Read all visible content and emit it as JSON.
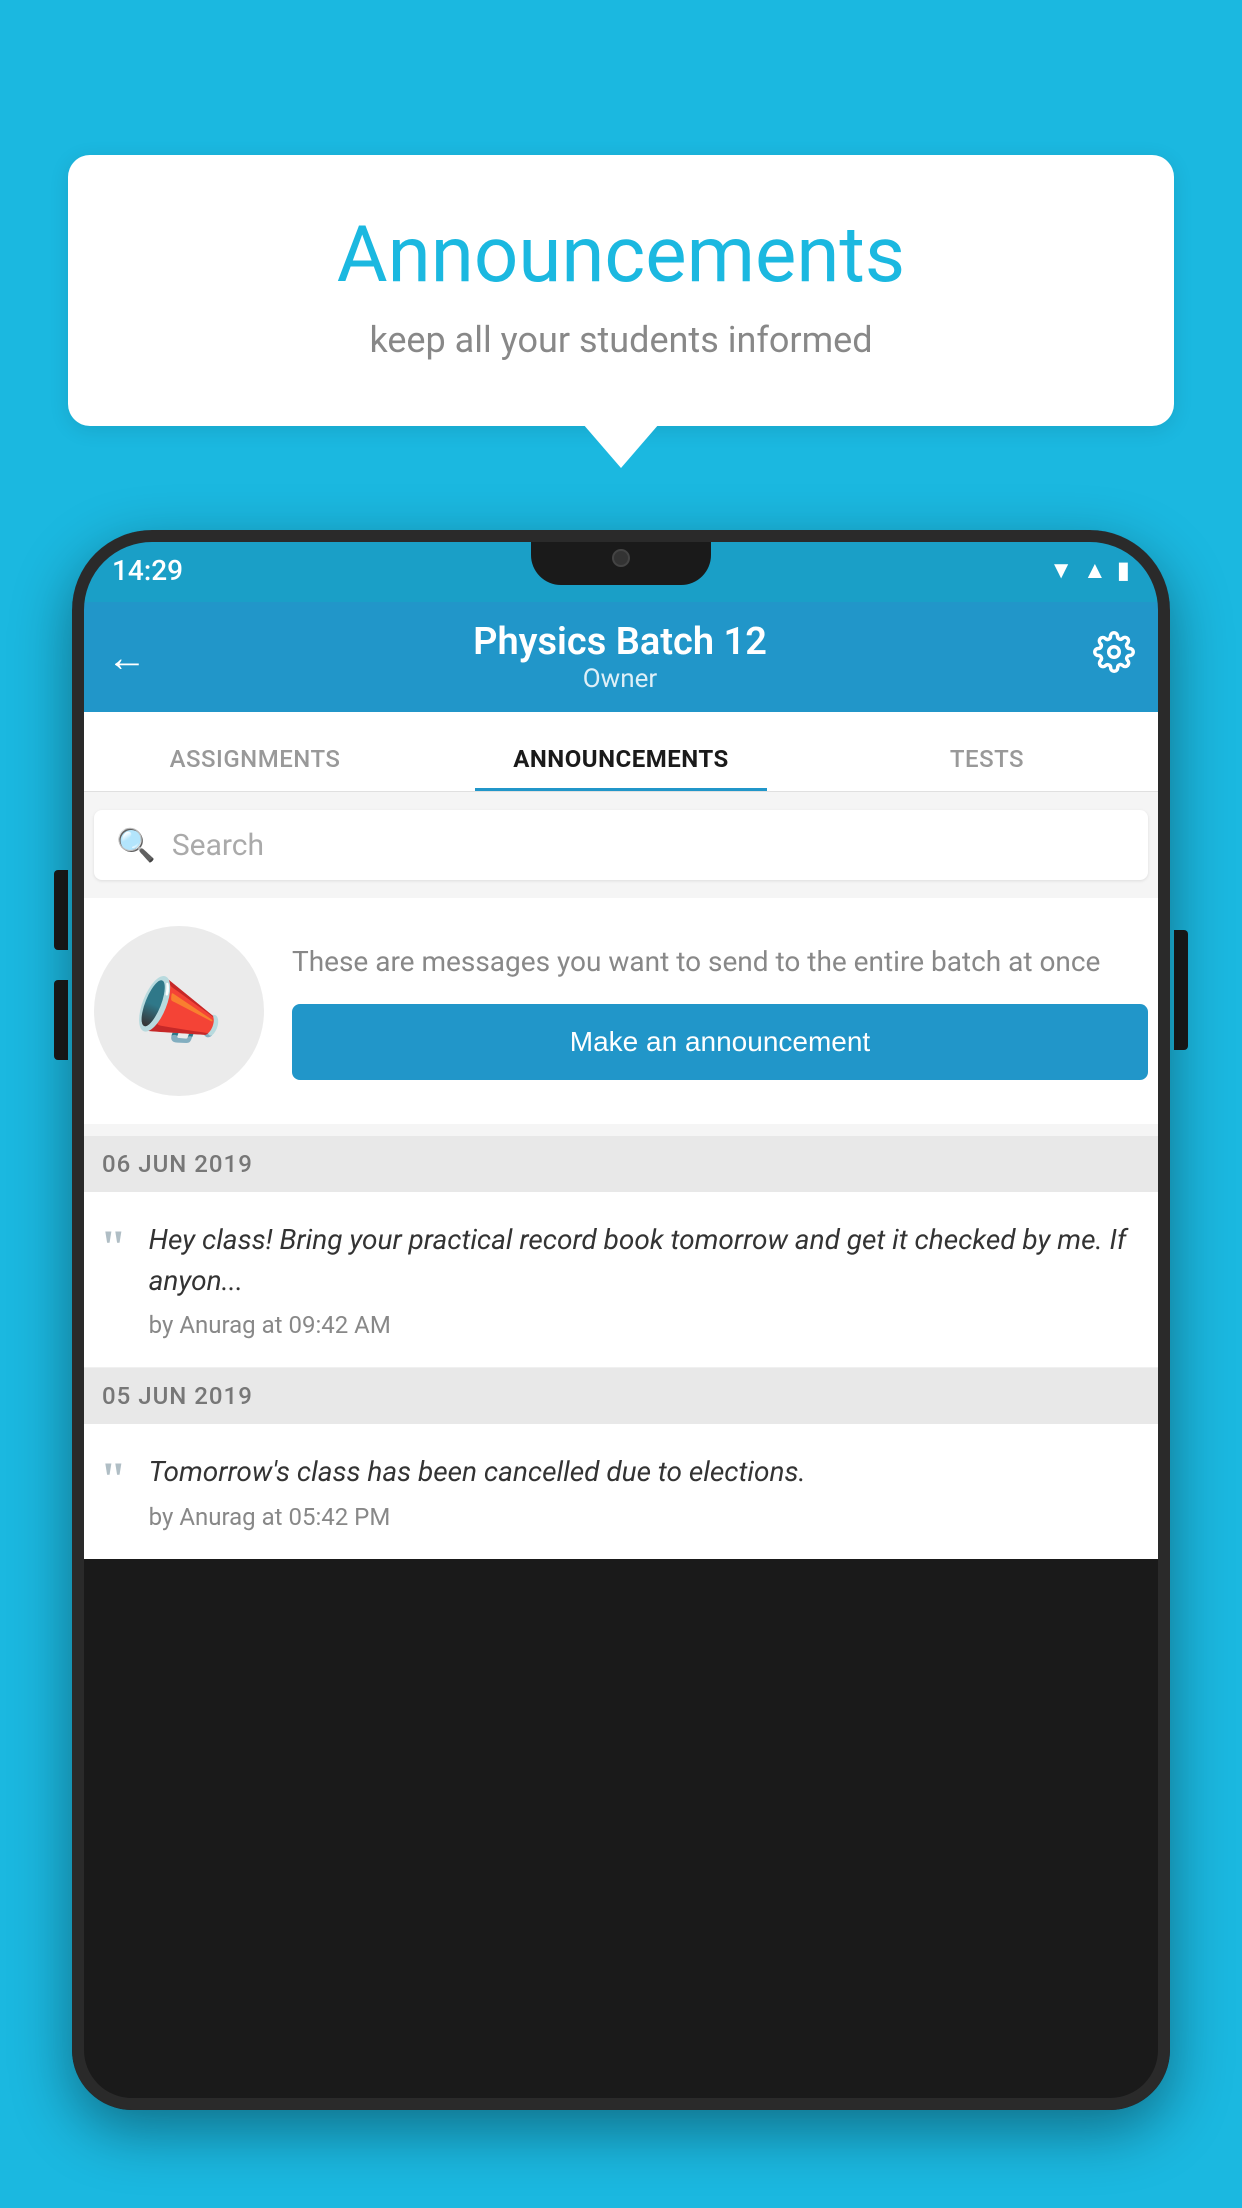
{
  "background_color": "#1bb8e0",
  "speech_bubble": {
    "title": "Announcements",
    "subtitle": "keep all your students informed"
  },
  "phone": {
    "status_bar": {
      "time": "14:29"
    },
    "header": {
      "back_label": "←",
      "title": "Physics Batch 12",
      "subtitle": "Owner",
      "gear_label": "⚙"
    },
    "tabs": [
      {
        "label": "ASSIGNMENTS",
        "active": false
      },
      {
        "label": "ANNOUNCEMENTS",
        "active": true
      },
      {
        "label": "TESTS",
        "active": false
      }
    ],
    "search": {
      "placeholder": "Search"
    },
    "announcement_prompt": {
      "description_text": "These are messages you want to send to the entire batch at once",
      "button_label": "Make an announcement"
    },
    "date_sections": [
      {
        "date": "06  JUN  2019",
        "announcements": [
          {
            "message": "Hey class! Bring your practical record book tomorrow and get it checked by me. If anyon...",
            "meta": "by Anurag at 09:42 AM"
          }
        ]
      },
      {
        "date": "05  JUN  2019",
        "announcements": [
          {
            "message": "Tomorrow's class has been cancelled due to elections.",
            "meta": "by Anurag at 05:42 PM"
          }
        ]
      }
    ]
  }
}
